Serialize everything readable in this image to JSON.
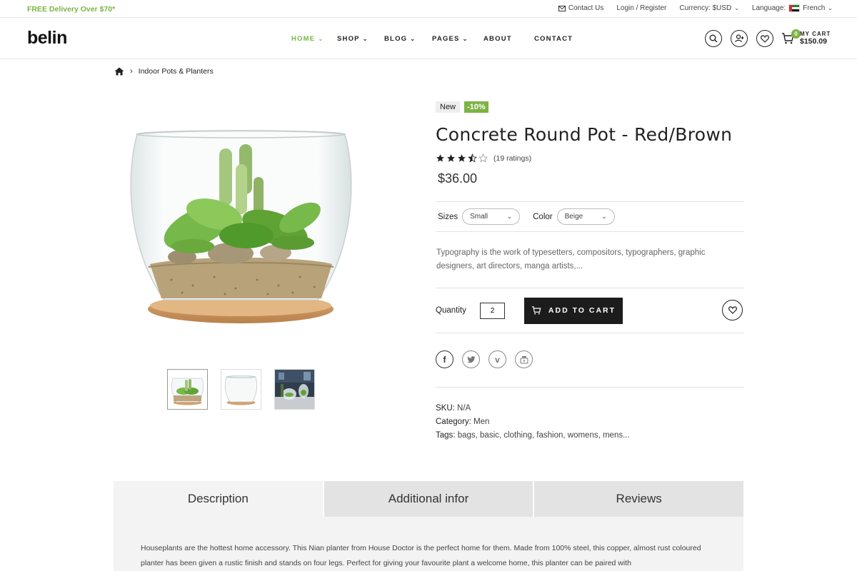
{
  "topbar": {
    "promo": "FREE Delivery Over $70*",
    "contact": "Contact Us",
    "login": "Login / Register",
    "currency": "Currency: $USD",
    "language_label": "Language:",
    "language": "French"
  },
  "header": {
    "logo": "belin",
    "nav": [
      {
        "label": "HOME",
        "active": true,
        "dropdown": true
      },
      {
        "label": "SHOP",
        "dropdown": true
      },
      {
        "label": "BLOG",
        "dropdown": true
      },
      {
        "label": "PAGES",
        "dropdown": true
      },
      {
        "label": "ABOUT",
        "dropdown": false
      },
      {
        "label": "CONTACT",
        "dropdown": false
      }
    ],
    "cart_count": "0",
    "cart_label": "MY CART",
    "cart_total": "$150.09"
  },
  "breadcrumb": {
    "current": "Indoor Pots & Planters"
  },
  "product": {
    "badge_new": "New",
    "badge_discount": "-10%",
    "title": "Concrete Round Pot - Red/Brown",
    "rating": 3.5,
    "rating_max": 5,
    "ratings_count": "(19 ratings)",
    "price": "$36.00",
    "sizes_label": "Sizes",
    "size_value": "Small",
    "color_label": "Color",
    "color_value": "Beige",
    "description": "Typography is the work of typesetters, compositors, typographers, graphic designers, art directors, manga artists,...",
    "quantity_label": "Quantity",
    "quantity": "2",
    "add_to_cart": "ADD TO CART",
    "sku_label": "SKU:",
    "sku": "N/A",
    "category_label": "Category:",
    "category": "Men",
    "tags_label": "Tags:",
    "tags": "bags, basic, clothing, fashion, womens, mens..."
  },
  "tabs": {
    "items": [
      "Description",
      "Additional infor",
      "Reviews"
    ],
    "body": "Houseplants are the hottest home accessory. This Nian planter from House Doctor is the perfect home for them. Made from 100% steel, this copper, almost rust coloured planter has been given a rustic finish and stands on four legs. Perfect for giving your favourite plant a welcome home, this planter can be paired with"
  },
  "colors": {
    "accent": "#7cb342",
    "dark_button": "#1c1c1c"
  }
}
